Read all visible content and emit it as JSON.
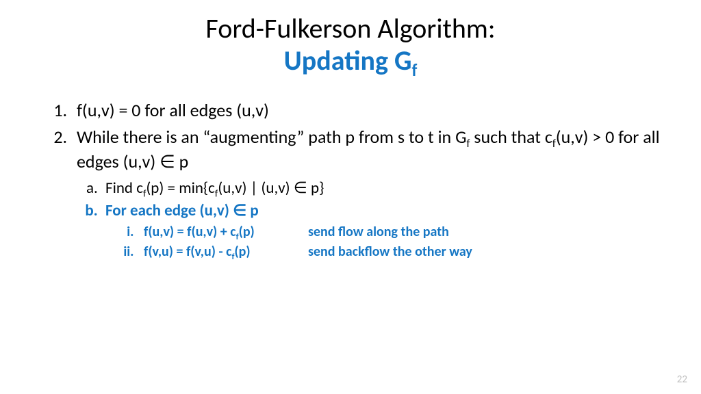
{
  "title": {
    "line1": "Ford-Fulkerson Algorithm:",
    "line2_pre": "Updating G",
    "line2_sub": "f"
  },
  "steps": {
    "s1": "f(u,v) = 0 for all edges (u,v)",
    "s2_a": "While there is an “augmenting” path p from s to t in G",
    "s2_sub": "f",
    "s2_b": " such that c",
    "s2_sub2": "f",
    "s2_c": "(u,v) > 0 for all edges (u,v) ∈ p",
    "a_pre": "Find c",
    "a_sub": "f",
    "a_mid": "(p) = min{c",
    "a_sub2": "f",
    "a_post": "(u,v) | (u,v) ∈ p}",
    "b": "For each edge (u,v) ∈ p",
    "i_eq_pre": "f(u,v) = f(u,v) + c",
    "i_eq_sub": "f",
    "i_eq_post": "(p)",
    "i_note": "send flow along the path",
    "ii_eq_pre": "f(v,u) = f(v,u) - c",
    "ii_eq_sub": "f",
    "ii_eq_post": "(p)",
    "ii_note": "send backflow the other way"
  },
  "page": "22"
}
